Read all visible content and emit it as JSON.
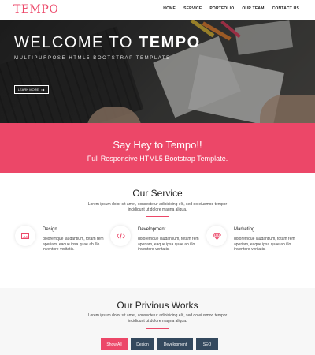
{
  "nav": {
    "logo": "TEMPO",
    "items": [
      "HOME",
      "SERVICE",
      "PORTFOLIO",
      "OUR TEAM",
      "CONTACT US"
    ],
    "active": "HOME"
  },
  "hero": {
    "title_light": "WELCOME TO ",
    "title_bold": "TEMPO",
    "subtitle": "MULTIPURPOSE HTML5 BOOTSTRAP TEMPLATE",
    "button_label": "LEARN MORE"
  },
  "banner": {
    "title": "Say Hey to Tempo!!",
    "subtitle": "Full Responsive HTML5 Bootstrap Template."
  },
  "services": {
    "title": "Our Service",
    "desc": "Lorem ipsum dolor sit amet, consectetur adipisicing elit, sed do eiusmod tempor incididunt ut dolore magna aliqua.",
    "items": [
      {
        "title": "Design",
        "text": "doloremque laudantium, totam rem aperiam, eaque ipsa quae ab illo inventore veritatis.",
        "icon": "image-icon"
      },
      {
        "title": "Development",
        "text": "doloremque laudantium, totam rem aperiam, eaque ipsa quae ab illo inventore veritatis.",
        "icon": "code-icon"
      },
      {
        "title": "Marketing",
        "text": "doloremque laudantium, totam rem aperiam, eaque ipsa quae ab illo inventore veritatis.",
        "icon": "diamond-icon"
      }
    ]
  },
  "works": {
    "title": "Our Privious Works",
    "desc": "Lorem ipsum dolor sit amet, consectetur adipisicing elit, sed do eiusmod tempor incididunt ut dolore magna aliqua.",
    "filters": [
      "Show All",
      "Design",
      "Development",
      "SEO"
    ],
    "active_filter": "Show All"
  },
  "colors": {
    "accent": "#ec4768",
    "dark_button": "#34495e"
  }
}
